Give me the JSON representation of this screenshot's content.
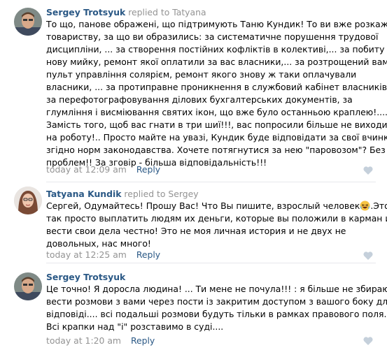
{
  "comments": [
    {
      "author": "Sergey Trotsyuk",
      "replied_text": "replied to Tatyana",
      "lines": [
        "То що, панове ображені, що підтримують Таню Кундик! То ви вже розкажіть",
        "товариству, за що ви образились: за систематичне порушення трудової",
        "дисципліни, ... за створення постійних кофліктів в колективі,... за побиту",
        "нову мийку, ремонт якої оплатили за вас власники,... за розтрощений вами",
        "пульт управління солярієм, ремонт якого знову ж таки оплачували",
        "власники, ... за протиправне проникнення в службовий кабінет власників,",
        "за перефотографовування ділових бухгалтерських документів, за",
        "глумління і висміювання святих ікон, що вже було останньою краплею!....",
        "Замість того, щоб вас гнати в три шиї!!!, вас попросили більше не виходити",
        "на роботу!.. Просто майте на увазі, Кундик буде відповідати за свої вчинки",
        "згідно норм законодавства. Хочете потягнутися за нею \"паровозом\"? Без",
        "проблем!! За зговір - більша відповідальність!!!"
      ],
      "time": "today at 12:09 am",
      "reply_label": "Reply"
    },
    {
      "author": "Tatyana Kundik",
      "replied_text": "replied to Sergey",
      "lines_pre": "Сергей, Одумайтесь! Прошу Вас! Что Вы пишите, взрослый человек",
      "line1_post": ".Это",
      "lines": [
        "так просто выплатить людям их деньги, которые вы положили в карман и",
        "вести свои дела честно! Это не моя личная история и не двух не",
        "довольных, нас много!"
      ],
      "time": "today at 12:25 am",
      "reply_label": "Reply",
      "emoji": "laughing-emoji"
    },
    {
      "author": "Sergey Trotsyuk",
      "lines": [
        "Це точно! Я доросла людина! ... Ти мене не почула!!! : я більше не збираюсь",
        "вести розмови з вами через пости із закритим доступом з вашого боку для",
        "відповіді.... всі подальші розмови будуть тільки в рамках правового поля.",
        "Всі крапки над \"і\" розставимо в суді...."
      ],
      "time": "today at 1:20 am",
      "reply_label": "Reply"
    }
  ],
  "colors": {
    "link": "#2a5885",
    "muted": "#939393",
    "divider": "#e7e8ec",
    "like": "#c5d0db"
  }
}
